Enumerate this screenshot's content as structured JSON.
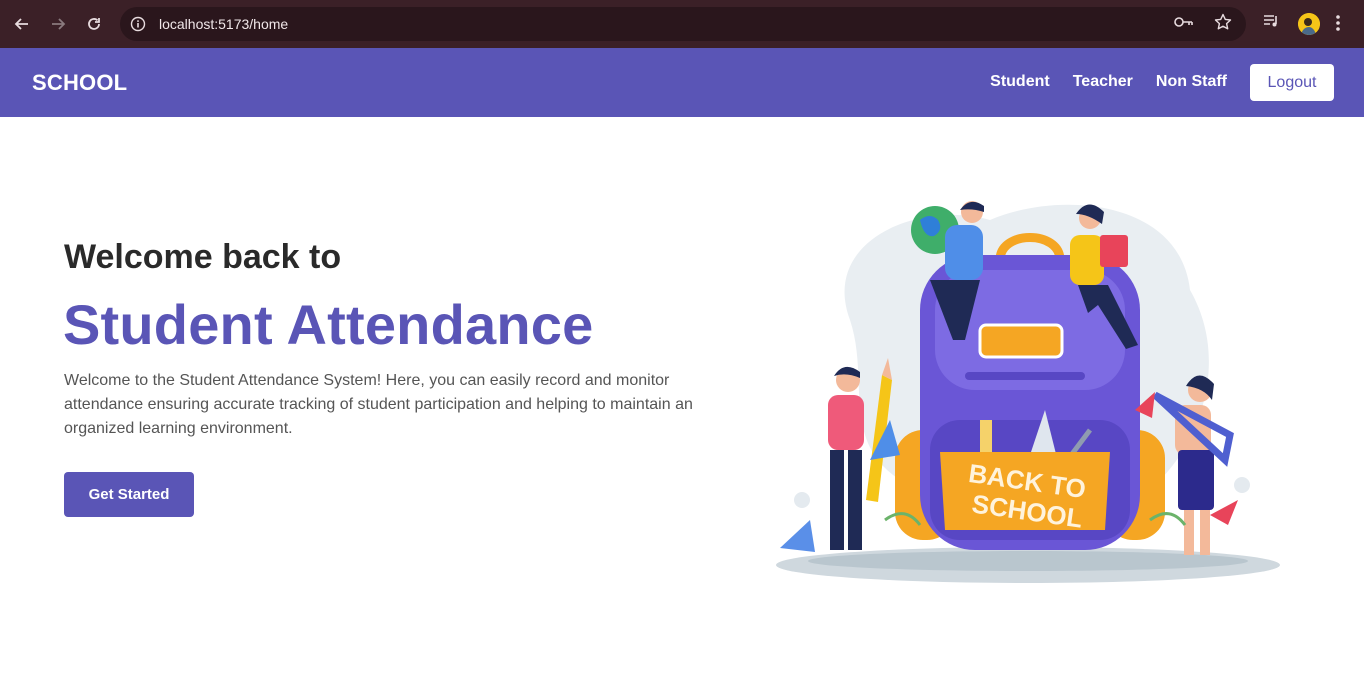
{
  "browser": {
    "url": "localhost:5173/home"
  },
  "navbar": {
    "brand": "SCHOOL",
    "links": [
      "Student",
      "Teacher",
      "Non Staff"
    ],
    "logout_label": "Logout"
  },
  "hero": {
    "subtitle": "Welcome back to",
    "title": "Student Attendance",
    "description": "Welcome to the Student Attendance System! Here, you can easily record and monitor attendance ensuring accurate tracking of student participation and helping to maintain an organized learning environment.",
    "cta_label": "Get Started"
  },
  "illustration": {
    "bag_text_line1": "BACK TO",
    "bag_text_line2": "SCHOOL"
  },
  "colors": {
    "primary": "#5a55b6",
    "chrome": "#3b2027"
  }
}
